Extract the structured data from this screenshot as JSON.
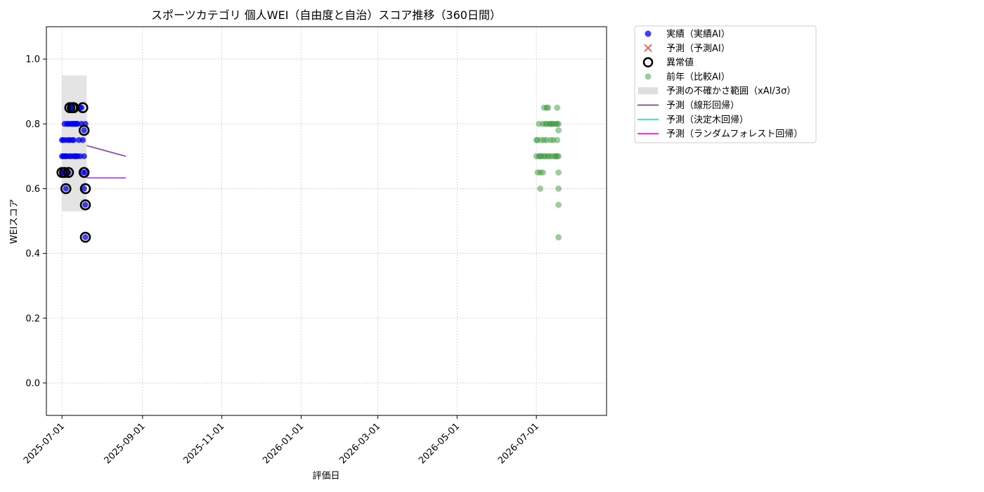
{
  "chart_data": {
    "type": "scatter",
    "title": "スポーツカテゴリ 個人WEI（自由度と自治）スコア推移（360日間）",
    "xlabel": "評価日",
    "ylabel": "WEIスコア",
    "xlim": [
      "2025-06-19",
      "2026-08-24"
    ],
    "ylim": [
      -0.1,
      1.1
    ],
    "grid": true,
    "x_ticks": [
      "2025-07-01",
      "2025-09-01",
      "2025-11-01",
      "2026-01-01",
      "2026-03-01",
      "2026-05-01",
      "2026-07-01"
    ],
    "y_ticks": [
      "0.0",
      "0.2",
      "0.4",
      "0.6",
      "0.8",
      "1.0"
    ],
    "legend_position": "outside-top-right",
    "legend": [
      {
        "label": "実績（実績AI）",
        "kind": "dot",
        "color": "#0000ee"
      },
      {
        "label": "予測（予測AI）",
        "kind": "x",
        "color": "#ff3333"
      },
      {
        "label": "異常値",
        "kind": "ring",
        "color": "#000000"
      },
      {
        "label": "前年（比較AI）",
        "kind": "dot",
        "color": "#3a9e3a"
      },
      {
        "label": "予測の不確かさ範囲（xAI/3σ）",
        "kind": "band",
        "color": "#dddddd"
      },
      {
        "label": "予測（線形回帰）",
        "kind": "line",
        "color": "#7b1fa2"
      },
      {
        "label": "予測（決定木回帰）",
        "kind": "line",
        "color": "#00e5ee"
      },
      {
        "label": "予測（ランダムフォレスト回帰）",
        "kind": "line",
        "color": "#ff00ff"
      }
    ],
    "uncertainty_band": {
      "x": [
        "2025-07-01",
        "2025-07-20"
      ],
      "y": [
        0.53,
        0.95
      ]
    },
    "actual_points": [
      {
        "x": "2025-07-01",
        "y": 0.65
      },
      {
        "x": "2025-07-01",
        "y": 0.7
      },
      {
        "x": "2025-07-01",
        "y": 0.75
      },
      {
        "x": "2025-07-02",
        "y": 0.65
      },
      {
        "x": "2025-07-02",
        "y": 0.7
      },
      {
        "x": "2025-07-02",
        "y": 0.75
      },
      {
        "x": "2025-07-03",
        "y": 0.65
      },
      {
        "x": "2025-07-03",
        "y": 0.7
      },
      {
        "x": "2025-07-03",
        "y": 0.8
      },
      {
        "x": "2025-07-04",
        "y": 0.6
      },
      {
        "x": "2025-07-04",
        "y": 0.7
      },
      {
        "x": "2025-07-04",
        "y": 0.75
      },
      {
        "x": "2025-07-05",
        "y": 0.65
      },
      {
        "x": "2025-07-05",
        "y": 0.8
      },
      {
        "x": "2025-07-05",
        "y": 0.7
      },
      {
        "x": "2025-07-06",
        "y": 0.65
      },
      {
        "x": "2025-07-06",
        "y": 0.75
      },
      {
        "x": "2025-07-06",
        "y": 0.8
      },
      {
        "x": "2025-07-07",
        "y": 0.85
      },
      {
        "x": "2025-07-07",
        "y": 0.7
      },
      {
        "x": "2025-07-07",
        "y": 0.75
      },
      {
        "x": "2025-07-08",
        "y": 0.8
      },
      {
        "x": "2025-07-08",
        "y": 0.7
      },
      {
        "x": "2025-07-08",
        "y": 0.85
      },
      {
        "x": "2025-07-09",
        "y": 0.85
      },
      {
        "x": "2025-07-09",
        "y": 0.75
      },
      {
        "x": "2025-07-09",
        "y": 0.8
      },
      {
        "x": "2025-07-10",
        "y": 0.8
      },
      {
        "x": "2025-07-10",
        "y": 0.7
      },
      {
        "x": "2025-07-10",
        "y": 0.75
      },
      {
        "x": "2025-07-11",
        "y": 0.7
      },
      {
        "x": "2025-07-11",
        "y": 0.8
      },
      {
        "x": "2025-07-12",
        "y": 0.7
      },
      {
        "x": "2025-07-12",
        "y": 0.8
      },
      {
        "x": "2025-07-13",
        "y": 0.7
      },
      {
        "x": "2025-07-13",
        "y": 0.8
      },
      {
        "x": "2025-07-14",
        "y": 0.75
      },
      {
        "x": "2025-07-15",
        "y": 0.85
      },
      {
        "x": "2025-07-15",
        "y": 0.7
      },
      {
        "x": "2025-07-16",
        "y": 0.8
      },
      {
        "x": "2025-07-16",
        "y": 0.85
      },
      {
        "x": "2025-07-17",
        "y": 0.75
      },
      {
        "x": "2025-07-17",
        "y": 0.65
      },
      {
        "x": "2025-07-18",
        "y": 0.78
      },
      {
        "x": "2025-07-18",
        "y": 0.7
      },
      {
        "x": "2025-07-18",
        "y": 0.6
      },
      {
        "x": "2025-07-19",
        "y": 0.8
      },
      {
        "x": "2025-07-19",
        "y": 0.55
      },
      {
        "x": "2025-07-19",
        "y": 0.45
      },
      {
        "x": "2025-07-19",
        "y": 0.65
      }
    ],
    "anomalies": [
      {
        "x": "2025-07-01",
        "y": 0.65
      },
      {
        "x": "2025-07-03",
        "y": 0.65
      },
      {
        "x": "2025-07-04",
        "y": 0.6
      },
      {
        "x": "2025-07-06",
        "y": 0.65
      },
      {
        "x": "2025-07-07",
        "y": 0.85
      },
      {
        "x": "2025-07-09",
        "y": 0.85
      },
      {
        "x": "2025-07-10",
        "y": 0.85
      },
      {
        "x": "2025-07-17",
        "y": 0.85
      },
      {
        "x": "2025-07-18",
        "y": 0.78
      },
      {
        "x": "2025-07-18",
        "y": 0.65
      },
      {
        "x": "2025-07-19",
        "y": 0.6
      },
      {
        "x": "2025-07-19",
        "y": 0.55
      },
      {
        "x": "2025-07-19",
        "y": 0.45
      }
    ],
    "previous_year_points": [
      {
        "x": "2026-07-01",
        "y": 0.7
      },
      {
        "x": "2026-07-01",
        "y": 0.75
      },
      {
        "x": "2026-07-02",
        "y": 0.65
      },
      {
        "x": "2026-07-02",
        "y": 0.75
      },
      {
        "x": "2026-07-03",
        "y": 0.8
      },
      {
        "x": "2026-07-03",
        "y": 0.7
      },
      {
        "x": "2026-07-04",
        "y": 0.6
      },
      {
        "x": "2026-07-04",
        "y": 0.65
      },
      {
        "x": "2026-07-04",
        "y": 0.7
      },
      {
        "x": "2026-07-05",
        "y": 0.75
      },
      {
        "x": "2026-07-05",
        "y": 0.7
      },
      {
        "x": "2026-07-06",
        "y": 0.65
      },
      {
        "x": "2026-07-06",
        "y": 0.8
      },
      {
        "x": "2026-07-07",
        "y": 0.85
      },
      {
        "x": "2026-07-07",
        "y": 0.75
      },
      {
        "x": "2026-07-07",
        "y": 0.7
      },
      {
        "x": "2026-07-08",
        "y": 0.8
      },
      {
        "x": "2026-07-08",
        "y": 0.7
      },
      {
        "x": "2026-07-09",
        "y": 0.85
      },
      {
        "x": "2026-07-09",
        "y": 0.8
      },
      {
        "x": "2026-07-09",
        "y": 0.75
      },
      {
        "x": "2026-07-10",
        "y": 0.85
      },
      {
        "x": "2026-07-10",
        "y": 0.7
      },
      {
        "x": "2026-07-11",
        "y": 0.8
      },
      {
        "x": "2026-07-11",
        "y": 0.7
      },
      {
        "x": "2026-07-12",
        "y": 0.8
      },
      {
        "x": "2026-07-12",
        "y": 0.75
      },
      {
        "x": "2026-07-13",
        "y": 0.7
      },
      {
        "x": "2026-07-13",
        "y": 0.8
      },
      {
        "x": "2026-07-14",
        "y": 0.8
      },
      {
        "x": "2026-07-14",
        "y": 0.75
      },
      {
        "x": "2026-07-15",
        "y": 0.7
      },
      {
        "x": "2026-07-16",
        "y": 0.8
      },
      {
        "x": "2026-07-16",
        "y": 0.7
      },
      {
        "x": "2026-07-17",
        "y": 0.85
      },
      {
        "x": "2026-07-17",
        "y": 0.75
      },
      {
        "x": "2026-07-17",
        "y": 0.7
      },
      {
        "x": "2026-07-17",
        "y": 0.8
      },
      {
        "x": "2026-07-18",
        "y": 0.78
      },
      {
        "x": "2026-07-18",
        "y": 0.7
      },
      {
        "x": "2026-07-18",
        "y": 0.65
      },
      {
        "x": "2026-07-18",
        "y": 0.6
      },
      {
        "x": "2026-07-18",
        "y": 0.55
      },
      {
        "x": "2026-07-18",
        "y": 0.45
      },
      {
        "x": "2026-07-18",
        "y": 0.8
      }
    ],
    "forecast_lines": [
      {
        "name": "予測（線形回帰）",
        "color": "#7b1fa2",
        "points": [
          {
            "x": "2025-07-20",
            "y": 0.733
          },
          {
            "x": "2025-08-19",
            "y": 0.7
          }
        ]
      },
      {
        "name": "予測（決定木回帰）",
        "color": "#00e5ee",
        "points": [
          {
            "x": "2025-07-20",
            "y": 0.633
          },
          {
            "x": "2025-08-19",
            "y": 0.633
          }
        ]
      },
      {
        "name": "予測（ランダムフォレスト回帰）",
        "color": "#ff00ff",
        "points": [
          {
            "x": "2025-07-20",
            "y": 0.633
          },
          {
            "x": "2025-08-19",
            "y": 0.633
          }
        ]
      }
    ]
  }
}
